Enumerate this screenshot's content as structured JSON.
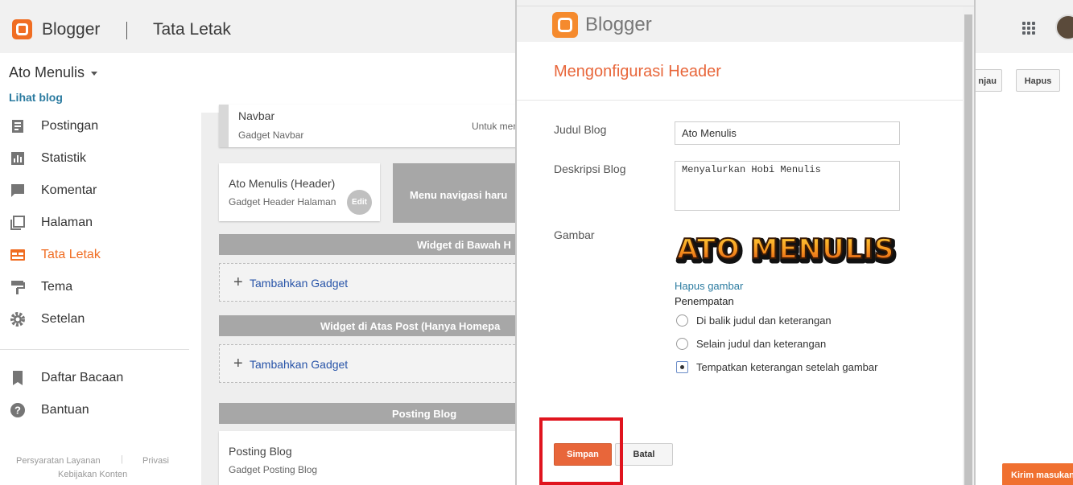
{
  "app": {
    "brand": "Blogger",
    "section_title": "Tata Letak"
  },
  "blog": {
    "name": "Ato Menulis",
    "view_link": "Lihat blog"
  },
  "header_actions": {
    "preview_label": "njau",
    "delete_label": "Hapus"
  },
  "sidebar": {
    "items": [
      {
        "label": "Postingan",
        "icon": "posts-icon"
      },
      {
        "label": "Statistik",
        "icon": "stats-icon"
      },
      {
        "label": "Komentar",
        "icon": "comment-icon"
      },
      {
        "label": "Halaman",
        "icon": "pages-icon"
      },
      {
        "label": "Tata Letak",
        "icon": "layout-icon",
        "active": true
      },
      {
        "label": "Tema",
        "icon": "theme-icon"
      },
      {
        "label": "Setelan",
        "icon": "settings-icon"
      }
    ],
    "secondary": [
      {
        "label": "Daftar Bacaan",
        "icon": "bookmark-icon"
      },
      {
        "label": "Bantuan",
        "icon": "help-icon"
      }
    ],
    "footer": {
      "terms": "Persyaratan Layanan",
      "privacy": "Privasi",
      "content_policy": "Kebijakan Konten"
    }
  },
  "layout": {
    "navbar": {
      "title": "Navbar",
      "subtitle": "Gadget Navbar",
      "note": "Untuk men"
    },
    "header_gadget": {
      "title": "Ato Menulis (Header)",
      "subtitle": "Gadget Header Halaman",
      "edit_label": "Edit"
    },
    "menu_box": "Menu navigasi haru",
    "sections": [
      {
        "title": "Widget di Bawah H",
        "add_label": "Tambahkan Gadget"
      },
      {
        "title": "Widget di Atas Post (Hanya Homepa",
        "add_label": "Tambahkan Gadget"
      },
      {
        "title": "Posting Blog"
      }
    ],
    "post_gadget": {
      "title": "Posting Blog",
      "subtitle": "Gadget Posting Blog"
    }
  },
  "dialog": {
    "brand": "Blogger",
    "title": "Mengonfigurasi Header",
    "fields": {
      "title_label": "Judul Blog",
      "title_value": "Ato Menulis",
      "desc_label": "Deskripsi Blog",
      "desc_value": "Menyalurkan Hobi Menulis",
      "image_label": "Gambar",
      "image_text": "ATO MENULIS",
      "remove_image": "Hapus gambar",
      "placement_label": "Penempatan"
    },
    "placement_options": [
      {
        "label": "Di balik judul dan keterangan",
        "checked": false
      },
      {
        "label": "Selain judul dan keterangan",
        "checked": false
      },
      {
        "label": "Tempatkan keterangan setelah gambar",
        "checked": true
      }
    ],
    "save_label": "Simpan",
    "cancel_label": "Batal"
  },
  "feedback": {
    "label": "Kirim masukan"
  },
  "colors": {
    "accent": "#f06d22",
    "dialog_title": "#e8663a",
    "highlight": "#e0141e",
    "link": "#2b7ba0"
  }
}
